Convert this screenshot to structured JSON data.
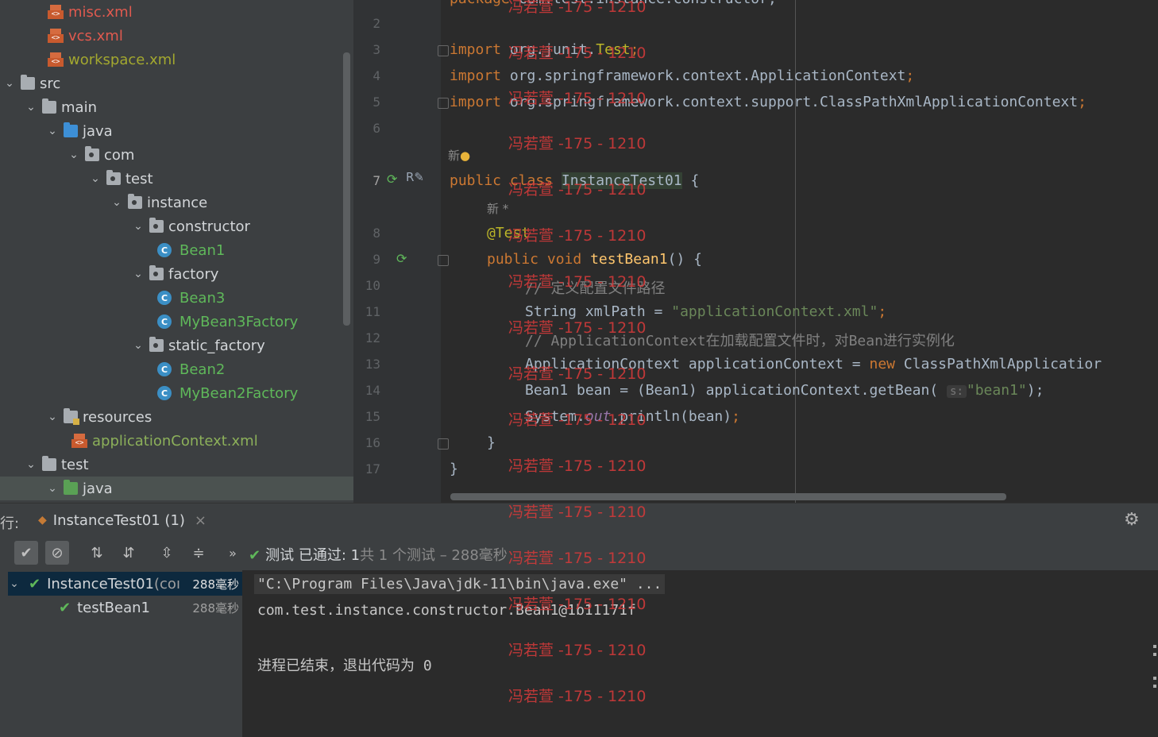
{
  "project_tree": {
    "items": [
      {
        "label": "misc.xml",
        "type": "xml",
        "indent": 60,
        "chev": "none",
        "color": "red"
      },
      {
        "label": "vcs.xml",
        "type": "xml",
        "indent": 60,
        "chev": "none",
        "color": "red"
      },
      {
        "label": "workspace.xml",
        "type": "xml",
        "indent": 60,
        "chev": "none",
        "color": "olive"
      },
      {
        "label": "src",
        "type": "folder",
        "indent": 4,
        "chev": "open",
        "color": "white"
      },
      {
        "label": "main",
        "type": "folder",
        "indent": 31,
        "chev": "open",
        "color": "white"
      },
      {
        "label": "java",
        "type": "folder-blue",
        "indent": 58,
        "chev": "open",
        "color": "white"
      },
      {
        "label": "com",
        "type": "package",
        "indent": 85,
        "chev": "open",
        "color": "white"
      },
      {
        "label": "test",
        "type": "package",
        "indent": 112,
        "chev": "open",
        "color": "white"
      },
      {
        "label": "instance",
        "type": "package",
        "indent": 139,
        "chev": "open",
        "color": "white"
      },
      {
        "label": "constructor",
        "type": "package",
        "indent": 166,
        "chev": "open",
        "color": "white"
      },
      {
        "label": "Bean1",
        "type": "class",
        "indent": 198,
        "chev": "none",
        "color": "green"
      },
      {
        "label": "factory",
        "type": "package",
        "indent": 166,
        "chev": "open",
        "color": "white"
      },
      {
        "label": "Bean3",
        "type": "class",
        "indent": 198,
        "chev": "none",
        "color": "green"
      },
      {
        "label": "MyBean3Factory",
        "type": "class",
        "indent": 198,
        "chev": "none",
        "color": "green"
      },
      {
        "label": "static_factory",
        "type": "package",
        "indent": 166,
        "chev": "open",
        "color": "white"
      },
      {
        "label": "Bean2",
        "type": "class",
        "indent": 198,
        "chev": "none",
        "color": "green"
      },
      {
        "label": "MyBean2Factory",
        "type": "class",
        "indent": 198,
        "chev": "none",
        "color": "green"
      },
      {
        "label": "resources",
        "type": "resources",
        "indent": 58,
        "chev": "open",
        "color": "white"
      },
      {
        "label": "applicationContext.xml",
        "type": "xml",
        "indent": 90,
        "chev": "none",
        "color": "greenxml"
      },
      {
        "label": "test",
        "type": "folder",
        "indent": 31,
        "chev": "open",
        "color": "white"
      },
      {
        "label": "java",
        "type": "folder-green",
        "indent": 58,
        "chev": "open",
        "color": "white",
        "selected": true
      }
    ]
  },
  "editor": {
    "line_numbers": [
      "2",
      "3",
      "4",
      "5",
      "6",
      "7",
      "8",
      "9",
      "10",
      "11",
      "12",
      "13",
      "14",
      "15",
      "16",
      "17"
    ],
    "current_line": "7",
    "author_hint_1": "新",
    "author_hint_2": "新 *",
    "line3": {
      "kw": "import",
      "pkg": " org.junit.",
      "cls": "Test"
    },
    "line4": {
      "kw": "import",
      "pkg": " org.springframework.context.ApplicationContext"
    },
    "line5": {
      "kw": "import",
      "pkg": " org.springframework.context.support.ClassPathXmlApplicationContext"
    },
    "line7": {
      "kw1": "public",
      "kw2": "class",
      "name": "InstanceTest01",
      "brace": " {"
    },
    "line8": {
      "ann": "@Test"
    },
    "line9": {
      "kw1": "public",
      "kw2": "void",
      "fn": "testBean1",
      "rest": "() {"
    },
    "line10": {
      "comment": "// 定义配置文件路径"
    },
    "line11": {
      "type": "String xmlPath = ",
      "str": "\"applicationContext.xml\""
    },
    "line12": {
      "comment": "// ApplicationContext在加载配置文件时，对Bean进行实例化"
    },
    "line13": {
      "left": "ApplicationContext applicationContext = ",
      "kw": "new",
      "right": " ClassPathXmlApplicatior"
    },
    "line14": {
      "left": "Bean1 bean = (Bean1) applicationContext.getBean(",
      "hint": "s:",
      "str": "\"bean1\"",
      "right": ");"
    },
    "line15": {
      "left": "System.",
      "static": "out",
      "right": ".println(bean)"
    },
    "line16": {
      "text": "}"
    },
    "line17": {
      "text": "}"
    }
  },
  "run_panel": {
    "prefix": "行:",
    "tab_label": "InstanceTest01 (1)",
    "status": {
      "label": "测试 已通过:",
      "count": " 1",
      "rest": "共 1 个测试 – 288毫秒"
    },
    "test_tree": [
      {
        "label": "InstanceTest01",
        "suffix": " (coı",
        "time": "288毫秒",
        "selected": true
      },
      {
        "label": "testBean1",
        "time": "288毫秒"
      }
    ],
    "console": {
      "cmd": "\"C:\\Program Files\\Java\\jdk-11\\bin\\java.exe\" ...",
      "out": "com.test.instance.constructor.Bean1@1b11171f",
      "exit": "进程已结束，退出代码为 0"
    }
  },
  "watermark": "冯若萱 -175 - 1210",
  "colors": {
    "keyword": "#cc7832",
    "string": "#6a8759",
    "annotation": "#bbb529",
    "comment": "#808080",
    "pass": "#5fb85a"
  }
}
